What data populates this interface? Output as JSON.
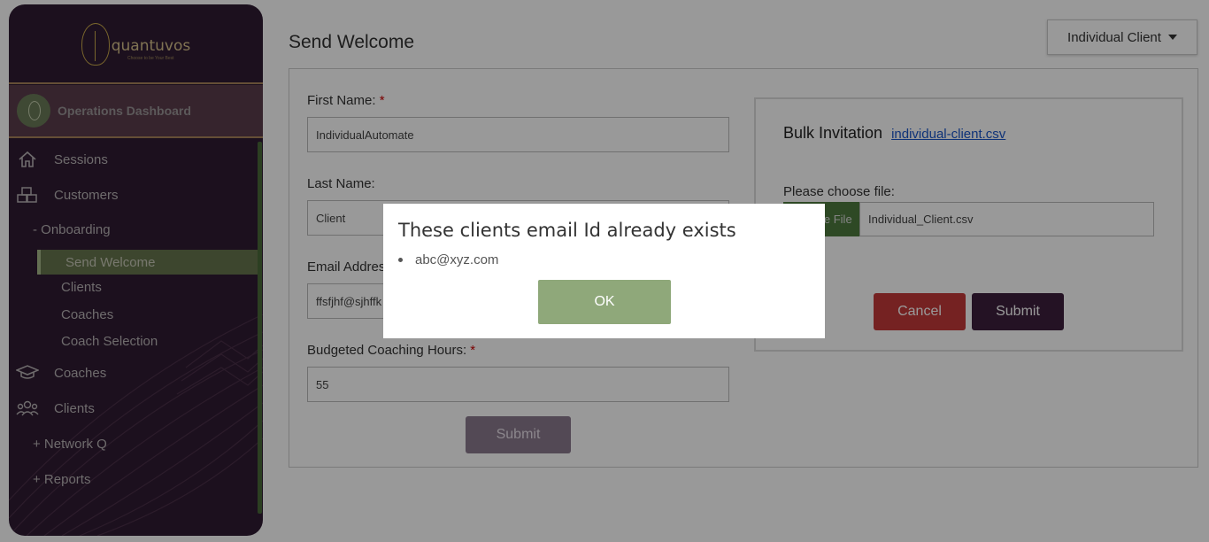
{
  "sidebar": {
    "logo_text": "quantuvos",
    "logo_tagline": "Choose to be Your Best",
    "dashboard_title": "Operations Dashboard",
    "items": [
      {
        "label": "Sessions",
        "icon": "home-icon"
      },
      {
        "label": "Customers",
        "icon": "boxes-icon"
      },
      {
        "label": "Coaches",
        "icon": "graduation-cap-icon"
      },
      {
        "label": "Clients",
        "icon": "users-icon"
      }
    ],
    "onboarding": "- Onboarding",
    "sub_items": [
      "Send Welcome",
      "Clients",
      "Coaches",
      "Coach Selection"
    ],
    "network_q": "+ Network Q",
    "reports": "+ Reports"
  },
  "header": {
    "title": "Send Welcome",
    "client_dropdown": "Individual Client"
  },
  "form": {
    "first_name_label": "First Name:",
    "first_name_value": "IndividualAutomate",
    "last_name_label": "Last Name:",
    "last_name_value": "Client",
    "email_label": "Email Address:",
    "email_value": "ffsfjhf@sjhffk",
    "hours_label": "Budgeted Coaching Hours:",
    "hours_value": "55",
    "required_mark": "*",
    "submit_label": "Submit"
  },
  "bulk": {
    "title": "Bulk Invitation",
    "link": "individual-client.csv",
    "choose_label": "Please choose file:",
    "file_button": "Choose File",
    "file_name": "Individual_Client.csv",
    "cancel_label": "Cancel",
    "submit_label": "Submit"
  },
  "modal": {
    "title": "These clients email Id already exists",
    "emails": [
      "abc@xyz.com"
    ],
    "ok_label": "OK"
  },
  "colors": {
    "sidebar_bg": "#2f1b33",
    "active_item": "#66764e",
    "ok_button": "#8fa87a",
    "cancel_button": "#c43a3a",
    "submit_button": "#3d1e3d"
  }
}
